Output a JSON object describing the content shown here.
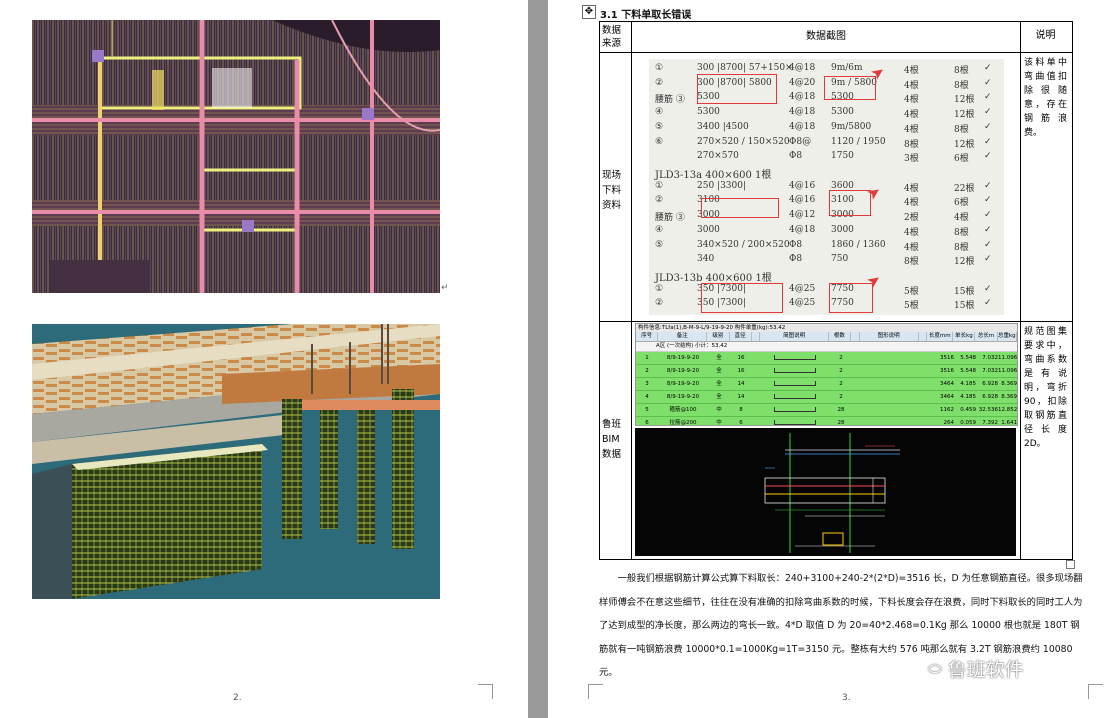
{
  "left_page": {
    "page_number": "2.",
    "figures": [
      "top-rebar-model-render",
      "bottom-rebar-model-render"
    ]
  },
  "right_page": {
    "section_title": "3.1 下料单取长错误",
    "table": {
      "headers": {
        "source": "数据来源",
        "screenshot": "数据截图",
        "note": "说明"
      },
      "rows": [
        {
          "source": "现场下料资料",
          "note": "该料单中弯曲值扣除很随意，存在钢筋浪费。",
          "photo_lines": [
            [
              "①",
              "300 |8700| 57+150×",
              "4@18",
              "9m/6m",
              "4根",
              "8根"
            ],
            [
              "②",
              "300 |8700| 5800",
              "4@20",
              "9m / 5800",
              "4根",
              "8根"
            ],
            [
              "腰筋 ③",
              "5300",
              "4@18",
              "5300",
              "4根",
              "12根"
            ],
            [
              "④",
              "5300",
              "4@18",
              "5300",
              "4根",
              "12根"
            ],
            [
              "⑤",
              "3400 |4500",
              "4@18",
              "9m/5800",
              "4根",
              "8根"
            ],
            [
              "⑥",
              "270×520 / 150×520",
              "Φ8@",
              "1120 / 1950",
              "8根",
              "12根"
            ],
            [
              "",
              "270×570",
              "Φ8",
              "1750",
              "3根",
              "6根"
            ],
            [
              "JLD3-13a 400×600 1根",
              "",
              "",
              "",
              "",
              ""
            ],
            [
              "①",
              "250 |3300|",
              "4@16",
              "3600",
              "4根",
              "22根"
            ],
            [
              "②",
              "3100",
              "4@16",
              "3100",
              "4根",
              "6根"
            ],
            [
              "腰筋 ③",
              "3000",
              "4@12",
              "3000",
              "2根",
              "4根"
            ],
            [
              "④",
              "3000",
              "4@18",
              "3000",
              "4根",
              "8根"
            ],
            [
              "⑤",
              "340×520 / 200×520",
              "Φ8",
              "1860 / 1360",
              "4根",
              "8根"
            ],
            [
              "",
              "340",
              "Φ8",
              "750",
              "8根",
              "12根"
            ],
            [
              "JLD3-13b 400×600 1根",
              "",
              "",
              "",
              "",
              ""
            ],
            [
              "①",
              "350 |7300|",
              "4@25",
              "7750",
              "5根",
              "15根"
            ],
            [
              "②",
              "350 |7300|",
              "4@25",
              "7750",
              "5根",
              "15根"
            ]
          ]
        },
        {
          "source": "鲁班BIM数据",
          "note": "规范图集要求中，弯曲系数是有说明，弯折90，扣除取钢筋直径长度2D。",
          "bim_title": "构件信息:TLfa(1),B-M-9-L/9-19-9-20    构件单重(kg):53.42",
          "bim_group": "A区 (一次结构) 小计：53.42",
          "bim_columns": [
            "序号",
            "备注",
            "级别",
            "直径mm",
            "",
            "简图说明",
            "根数",
            "",
            "图形说明",
            "",
            "长度mm",
            "单长kg",
            "总长m",
            "总重kg"
          ],
          "bim_rows": [
            {
              "no": "1",
              "note": "8/9-19-9-20",
              "grade": "全",
              "dia": "16",
              "count": "2",
              "len": "3516",
              "unit": "5.548",
              "total_m": "7.032",
              "total_kg": "11.096"
            },
            {
              "no": "2",
              "note": "8/9-19-9-20",
              "grade": "全",
              "dia": "16",
              "count": "2",
              "len": "3516",
              "unit": "5.548",
              "total_m": "7.032",
              "total_kg": "11.096"
            },
            {
              "no": "3",
              "note": "8/9-19-9-20",
              "grade": "全",
              "dia": "14",
              "count": "2",
              "len": "3464",
              "unit": "4.185",
              "total_m": "6.928",
              "total_kg": "8.369"
            },
            {
              "no": "4",
              "note": "8/9-19-9-20",
              "grade": "全",
              "dia": "14",
              "count": "2",
              "len": "3464",
              "unit": "4.185",
              "total_m": "6.928",
              "total_kg": "8.369"
            },
            {
              "no": "5",
              "note": "箍筋@100",
              "grade": "中",
              "dia": "8",
              "count": "28",
              "len": "1162",
              "unit": "0.459",
              "total_m": "32.536",
              "total_kg": "12.852"
            },
            {
              "no": "6",
              "note": "拉筋@200",
              "grade": "中",
              "dia": "6",
              "count": "28",
              "len": "264",
              "unit": "0.059",
              "total_m": "7.392",
              "total_kg": "1.641"
            }
          ]
        }
      ]
    },
    "paragraph": "一般我们根据钢筋计算公式算下料取长：240+3100+240-2*(2*D)=3516 长，D 为任意钢筋直径。很多现场翻样师傅会不在意这些细节，往往在没有准确的扣除弯曲系数的时候，下料长度会存在浪费，同时下料取长的同时工人为了达到成型的净长度，那么两边的弯长一致。4*D 取值 D 为 20=40*2.468=0.1Kg 那么 10000 根也就是 180T 钢筋就有一吨钢筋浪费 10000*0.1=1000Kg=1T=3150 元。整栋有大约 576 吨那么就有 3.2T 钢筋浪费约 10080 元。",
    "page_number": "3.",
    "watermark": "鲁班软件",
    "move_handle": "✥"
  },
  "colors": {
    "accent_red": "#e23a3a",
    "bim_green": "#7ee06a",
    "cad_black": "#050505"
  }
}
